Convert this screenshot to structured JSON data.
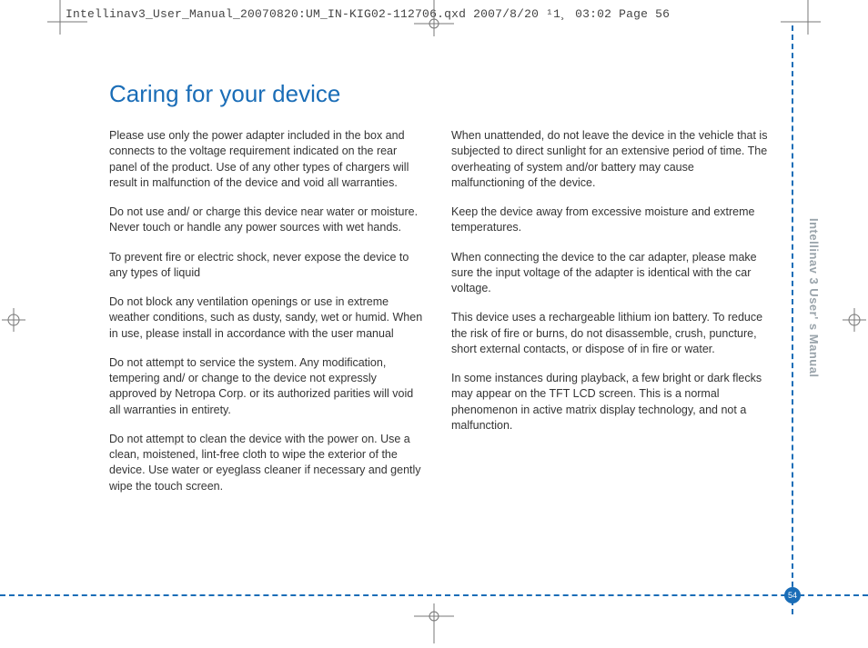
{
  "header": "Intellinav3_User_Manual_20070820:UM_IN-KIG02-112706.qxd  2007/8/20  ¹1¸  03:02  Page 56",
  "title": "Caring for your device",
  "side_label": "Intellinav 3 User' s Manual",
  "page_number": "54",
  "left_col": [
    "Please use only the power adapter included in the box and connects to the voltage requirement indicated on the rear panel of the product. Use of any other types of chargers will result in malfunction of the device and void all warranties.",
    "Do not use and/ or charge this device near water or moisture. Never touch or handle any power sources with wet hands.",
    "To prevent fire or electric shock, never expose the device to any types of liquid",
    "Do not block any ventilation openings or use in extreme weather conditions, such as dusty, sandy, wet or humid.  When in use, please install in accordance with the user manual",
    "Do not attempt to service the system. Any modification, tempering and/ or change to the device not expressly approved by Netropa Corp. or its authorized parities will void all warranties in entirety.",
    "Do not attempt to clean the device with the power on. Use a clean, moistened, lint-free cloth to wipe the exterior of the device. Use water or eyeglass cleaner if necessary and gently wipe the touch screen."
  ],
  "right_col": [
    "When unattended, do not leave the device in the vehicle that is subjected to direct sunlight for an extensive period of time. The overheating of system and/or battery may cause malfunctioning of the device.",
    "Keep the device away from excessive moisture and extreme temperatures.",
    "When connecting the device to the car adapter, please make sure the input voltage of the adapter is identical with the car voltage.",
    "This device uses a rechargeable lithium ion battery. To reduce the risk of fire or burns, do not disassemble, crush, puncture, short external contacts, or dispose of in fire or water.",
    "In some instances during playback, a few bright or dark flecks may appear on the TFT LCD screen. This is a normal phenomenon in active matrix display technology, and not a malfunction."
  ]
}
